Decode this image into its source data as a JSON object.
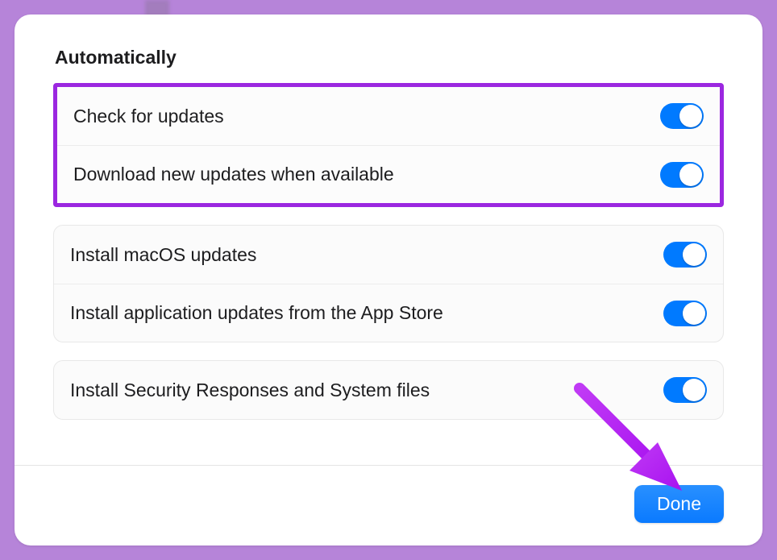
{
  "section_title": "Automatically",
  "group_highlighted": {
    "rows": [
      {
        "label": "Check for updates",
        "on": true
      },
      {
        "label": "Download new updates when available",
        "on": true
      }
    ]
  },
  "group_a": {
    "rows": [
      {
        "label": "Install macOS updates",
        "on": true
      },
      {
        "label": "Install application updates from the App Store",
        "on": true
      }
    ]
  },
  "group_b": {
    "rows": [
      {
        "label": "Install Security Responses and System files",
        "on": true
      }
    ]
  },
  "done_button": "Done",
  "accent_color": "#007aff",
  "highlight_color": "#9b27e0"
}
